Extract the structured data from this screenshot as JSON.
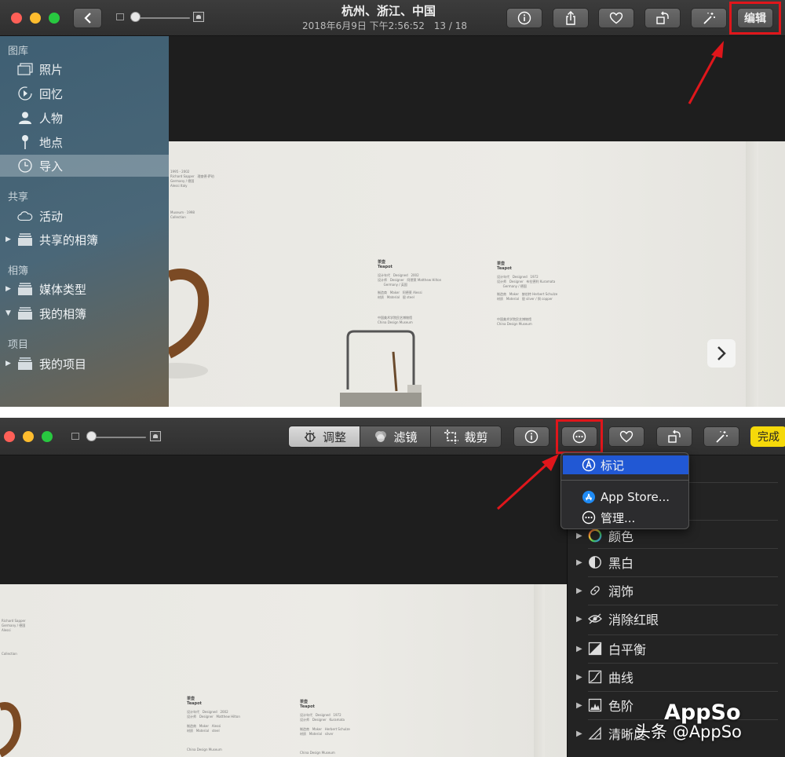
{
  "top_window": {
    "title": "杭州、浙江、中国",
    "subtitle": "2018年6月9日 下午2:56:52",
    "counter": "13 / 18",
    "edit_label": "编辑",
    "sidebar": {
      "sections": [
        {
          "label": "图库"
        },
        {
          "label": "共享"
        },
        {
          "label": "相簿"
        },
        {
          "label": "项目"
        }
      ],
      "items": [
        {
          "label": "照片",
          "icon": "photos-icon"
        },
        {
          "label": "回忆",
          "icon": "memories-icon"
        },
        {
          "label": "人物",
          "icon": "people-icon"
        },
        {
          "label": "地点",
          "icon": "places-icon"
        },
        {
          "label": "导入",
          "icon": "imports-icon"
        },
        {
          "label": "活动",
          "icon": "cloud-icon"
        },
        {
          "label": "共享的相簿",
          "icon": "album-stack-icon"
        },
        {
          "label": "媒体类型",
          "icon": "album-stack-icon"
        },
        {
          "label": "我的相簿",
          "icon": "album-stack-icon"
        },
        {
          "label": "我的项目",
          "icon": "album-stack-icon"
        }
      ]
    }
  },
  "bottom_window": {
    "tabs": [
      {
        "label": "调整",
        "icon": "adjust-icon",
        "active": true
      },
      {
        "label": "滤镜",
        "icon": "filters-icon",
        "active": false
      },
      {
        "label": "裁剪",
        "icon": "crop-icon",
        "active": false
      }
    ],
    "done_label": "完成",
    "extensions_menu": {
      "items": [
        {
          "label": "标记",
          "icon": "markup-icon",
          "highlighted": true
        },
        {
          "label": "App Store...",
          "icon": "app-store-icon",
          "highlighted": false
        },
        {
          "label": "管理...",
          "icon": "more-icon",
          "highlighted": false
        }
      ]
    },
    "adjustments": [
      {
        "label": "颜色",
        "icon": "color-icon"
      },
      {
        "label": "黑白",
        "icon": "black-white-icon"
      },
      {
        "label": "润饰",
        "icon": "retouch-icon"
      },
      {
        "label": "消除红眼",
        "icon": "red-eye-icon"
      },
      {
        "label": "白平衡",
        "icon": "white-balance-icon"
      },
      {
        "label": "曲线",
        "icon": "curves-icon"
      },
      {
        "label": "色阶",
        "icon": "levels-icon"
      },
      {
        "label": "清晰度",
        "icon": "definition-icon"
      }
    ]
  },
  "watermark": {
    "prefix": "头条",
    "handle": "@AppSo",
    "logo": "AppSo"
  },
  "colors": {
    "highlight_box": "#e0161b",
    "arrow": "#e0161b",
    "done_button": "#f5d90a",
    "menu_highlight": "#2158d4"
  }
}
